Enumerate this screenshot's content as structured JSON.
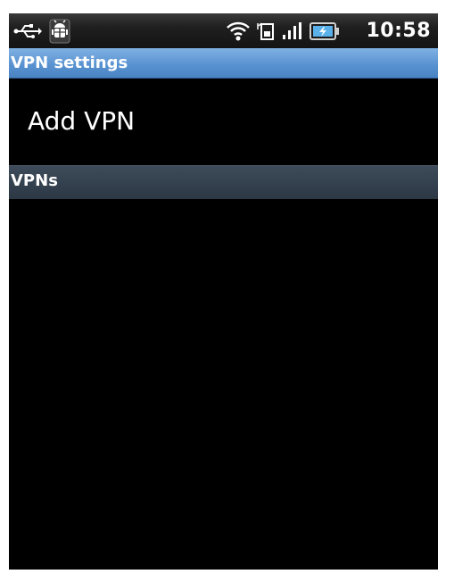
{
  "status_bar": {
    "time": "10:58",
    "icons": [
      "usb-icon",
      "debug-icon",
      "wifi-icon",
      "sim-icon",
      "signal-icon",
      "battery-icon"
    ]
  },
  "title_bar": {
    "title": "VPN settings"
  },
  "list": {
    "add_vpn_label": "Add VPN",
    "category_header": "VPNs",
    "vpns": []
  },
  "colors": {
    "title_bar": "#5a93d1",
    "category_header": "#2c3844",
    "background": "#000000",
    "text": "#ffffff",
    "battery_fill": "#5ab0e8"
  }
}
